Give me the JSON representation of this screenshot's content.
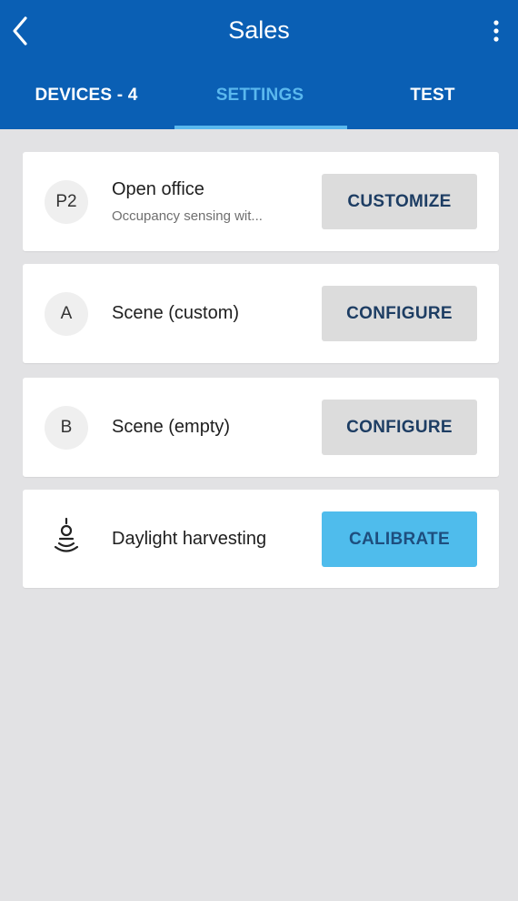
{
  "header": {
    "title": "Sales",
    "back_icon": "back-chevron-icon",
    "more_icon": "more-vertical-icon"
  },
  "tabs": [
    {
      "label": "DEVICES - 4",
      "active": false
    },
    {
      "label": "SETTINGS",
      "active": true
    },
    {
      "label": "TEST",
      "active": false
    }
  ],
  "cards": [
    {
      "badge": "P2",
      "title": "Open office",
      "subtitle": "Occupancy sensing wit...",
      "button": "CUSTOMIZE"
    },
    {
      "badge": "A",
      "title": "Scene (custom)",
      "button": "CONFIGURE"
    },
    {
      "badge": "B",
      "title": "Scene (empty)",
      "button": "CONFIGURE"
    },
    {
      "icon": "daylight-sensor-icon",
      "title": "Daylight harvesting",
      "button": "CALIBRATE"
    }
  ],
  "colors": {
    "app_bar": "#0a5fb4",
    "active_tab": "#5ab8ee",
    "background": "#e2e2e4",
    "secondary_button": "#dcdcdc",
    "primary_button": "#4fbcec"
  }
}
